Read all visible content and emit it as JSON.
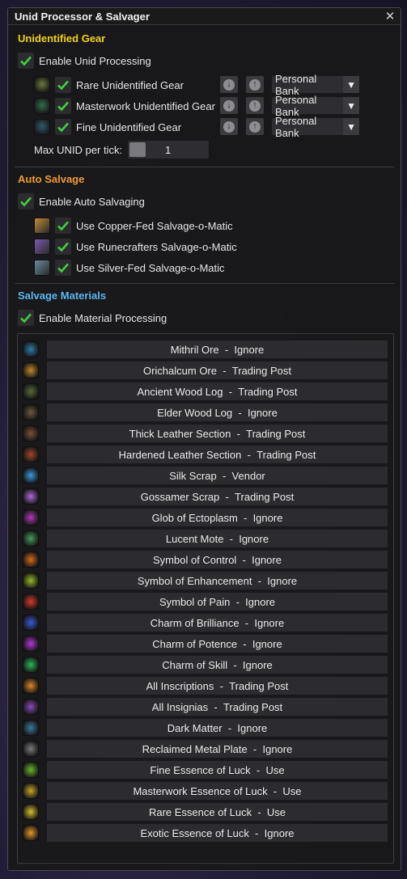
{
  "window": {
    "title": "Unid Processor & Salvager"
  },
  "colors": {
    "unid_header": "#f5d20a",
    "salvage_header": "#f09a2e",
    "materials_header": "#5bb7f0",
    "check": "#3fd23a"
  },
  "unid": {
    "header": "Unidentified Gear",
    "enable_label": "Enable Unid Processing",
    "items": [
      {
        "label": "Rare Unidentified Gear",
        "destination": "Personal Bank",
        "icon": "rare-unid-gear-icon",
        "icon_color": "#6a7a3a"
      },
      {
        "label": "Masterwork Unidentified Gear",
        "destination": "Personal Bank",
        "icon": "masterwork-unid-gear-icon",
        "icon_color": "#2f6e4a"
      },
      {
        "label": "Fine Unidentified Gear",
        "destination": "Personal Bank",
        "icon": "fine-unid-gear-icon",
        "icon_color": "#2e5a70"
      }
    ],
    "max_label": "Max UNID per tick:",
    "max_value": "1"
  },
  "salvage": {
    "header": "Auto Salvage",
    "enable_label": "Enable Auto Salvaging",
    "items": [
      {
        "label": "Use Copper-Fed Salvage-o-Matic",
        "icon": "copper-salvage-icon",
        "icon_color": "#c08a3a"
      },
      {
        "label": "Use Runecrafters Salvage-o-Matic",
        "icon": "runecrafter-salvage-icon",
        "icon_color": "#7a5ab0"
      },
      {
        "label": "Use Silver-Fed Salvage-o-Matic",
        "icon": "silver-salvage-icon",
        "icon_color": "#6a8aa0"
      }
    ]
  },
  "materials": {
    "header": "Salvage Materials",
    "enable_label": "Enable Material Processing",
    "items": [
      {
        "name": "Mithril Ore",
        "action": "Ignore",
        "icon": "mithril-ore-icon",
        "icon_color": "#2f7ea8"
      },
      {
        "name": "Orichalcum Ore",
        "action": "Trading Post",
        "icon": "orichalcum-ore-icon",
        "icon_color": "#c58a2a"
      },
      {
        "name": "Ancient Wood Log",
        "action": "Trading Post",
        "icon": "ancient-wood-log-icon",
        "icon_color": "#5a6a3a"
      },
      {
        "name": "Elder Wood Log",
        "action": "Ignore",
        "icon": "elder-wood-log-icon",
        "icon_color": "#6a5a3a"
      },
      {
        "name": "Thick Leather Section",
        "action": "Trading Post",
        "icon": "thick-leather-icon",
        "icon_color": "#7a5238"
      },
      {
        "name": "Hardened Leather Section",
        "action": "Trading Post",
        "icon": "hardened-leather-icon",
        "icon_color": "#a0482a"
      },
      {
        "name": "Silk Scrap",
        "action": "Vendor",
        "icon": "silk-scrap-icon",
        "icon_color": "#3a9ad8"
      },
      {
        "name": "Gossamer Scrap",
        "action": "Trading Post",
        "icon": "gossamer-scrap-icon",
        "icon_color": "#b06ad8"
      },
      {
        "name": "Glob of Ectoplasm",
        "action": "Ignore",
        "icon": "ectoplasm-icon",
        "icon_color": "#b03ab8"
      },
      {
        "name": "Lucent Mote",
        "action": "Ignore",
        "icon": "lucent-mote-icon",
        "icon_color": "#4a9a5a"
      },
      {
        "name": "Symbol of Control",
        "action": "Ignore",
        "icon": "symbol-control-icon",
        "icon_color": "#d86a1a"
      },
      {
        "name": "Symbol of Enhancement",
        "action": "Ignore",
        "icon": "symbol-enhancement-icon",
        "icon_color": "#9ab82a"
      },
      {
        "name": "Symbol of Pain",
        "action": "Ignore",
        "icon": "symbol-pain-icon",
        "icon_color": "#d83a2a"
      },
      {
        "name": "Charm of Brilliance",
        "action": "Ignore",
        "icon": "charm-brilliance-icon",
        "icon_color": "#3a5ad8"
      },
      {
        "name": "Charm of Potence",
        "action": "Ignore",
        "icon": "charm-potence-icon",
        "icon_color": "#b03ad8"
      },
      {
        "name": "Charm of Skill",
        "action": "Ignore",
        "icon": "charm-skill-icon",
        "icon_color": "#2ab85a"
      },
      {
        "name": "All Inscriptions",
        "action": "Trading Post",
        "icon": "inscriptions-icon",
        "icon_color": "#d8862a"
      },
      {
        "name": "All Insignias",
        "action": "Trading Post",
        "icon": "insignias-icon",
        "icon_color": "#8a4ab8"
      },
      {
        "name": "Dark Matter",
        "action": "Ignore",
        "icon": "dark-matter-icon",
        "icon_color": "#3a7a9a"
      },
      {
        "name": "Reclaimed Metal Plate",
        "action": "Ignore",
        "icon": "reclaimed-metal-icon",
        "icon_color": "#7a7a7a"
      },
      {
        "name": "Fine Essence of Luck",
        "action": "Use",
        "icon": "fine-luck-icon",
        "icon_color": "#6ab82a"
      },
      {
        "name": "Masterwork Essence of Luck",
        "action": "Use",
        "icon": "masterwork-luck-icon",
        "icon_color": "#c8a82a"
      },
      {
        "name": "Rare Essence of Luck",
        "action": "Use",
        "icon": "rare-luck-icon",
        "icon_color": "#d8c02a"
      },
      {
        "name": "Exotic Essence of Luck",
        "action": "Ignore",
        "icon": "exotic-luck-icon",
        "icon_color": "#e8962a"
      }
    ]
  }
}
